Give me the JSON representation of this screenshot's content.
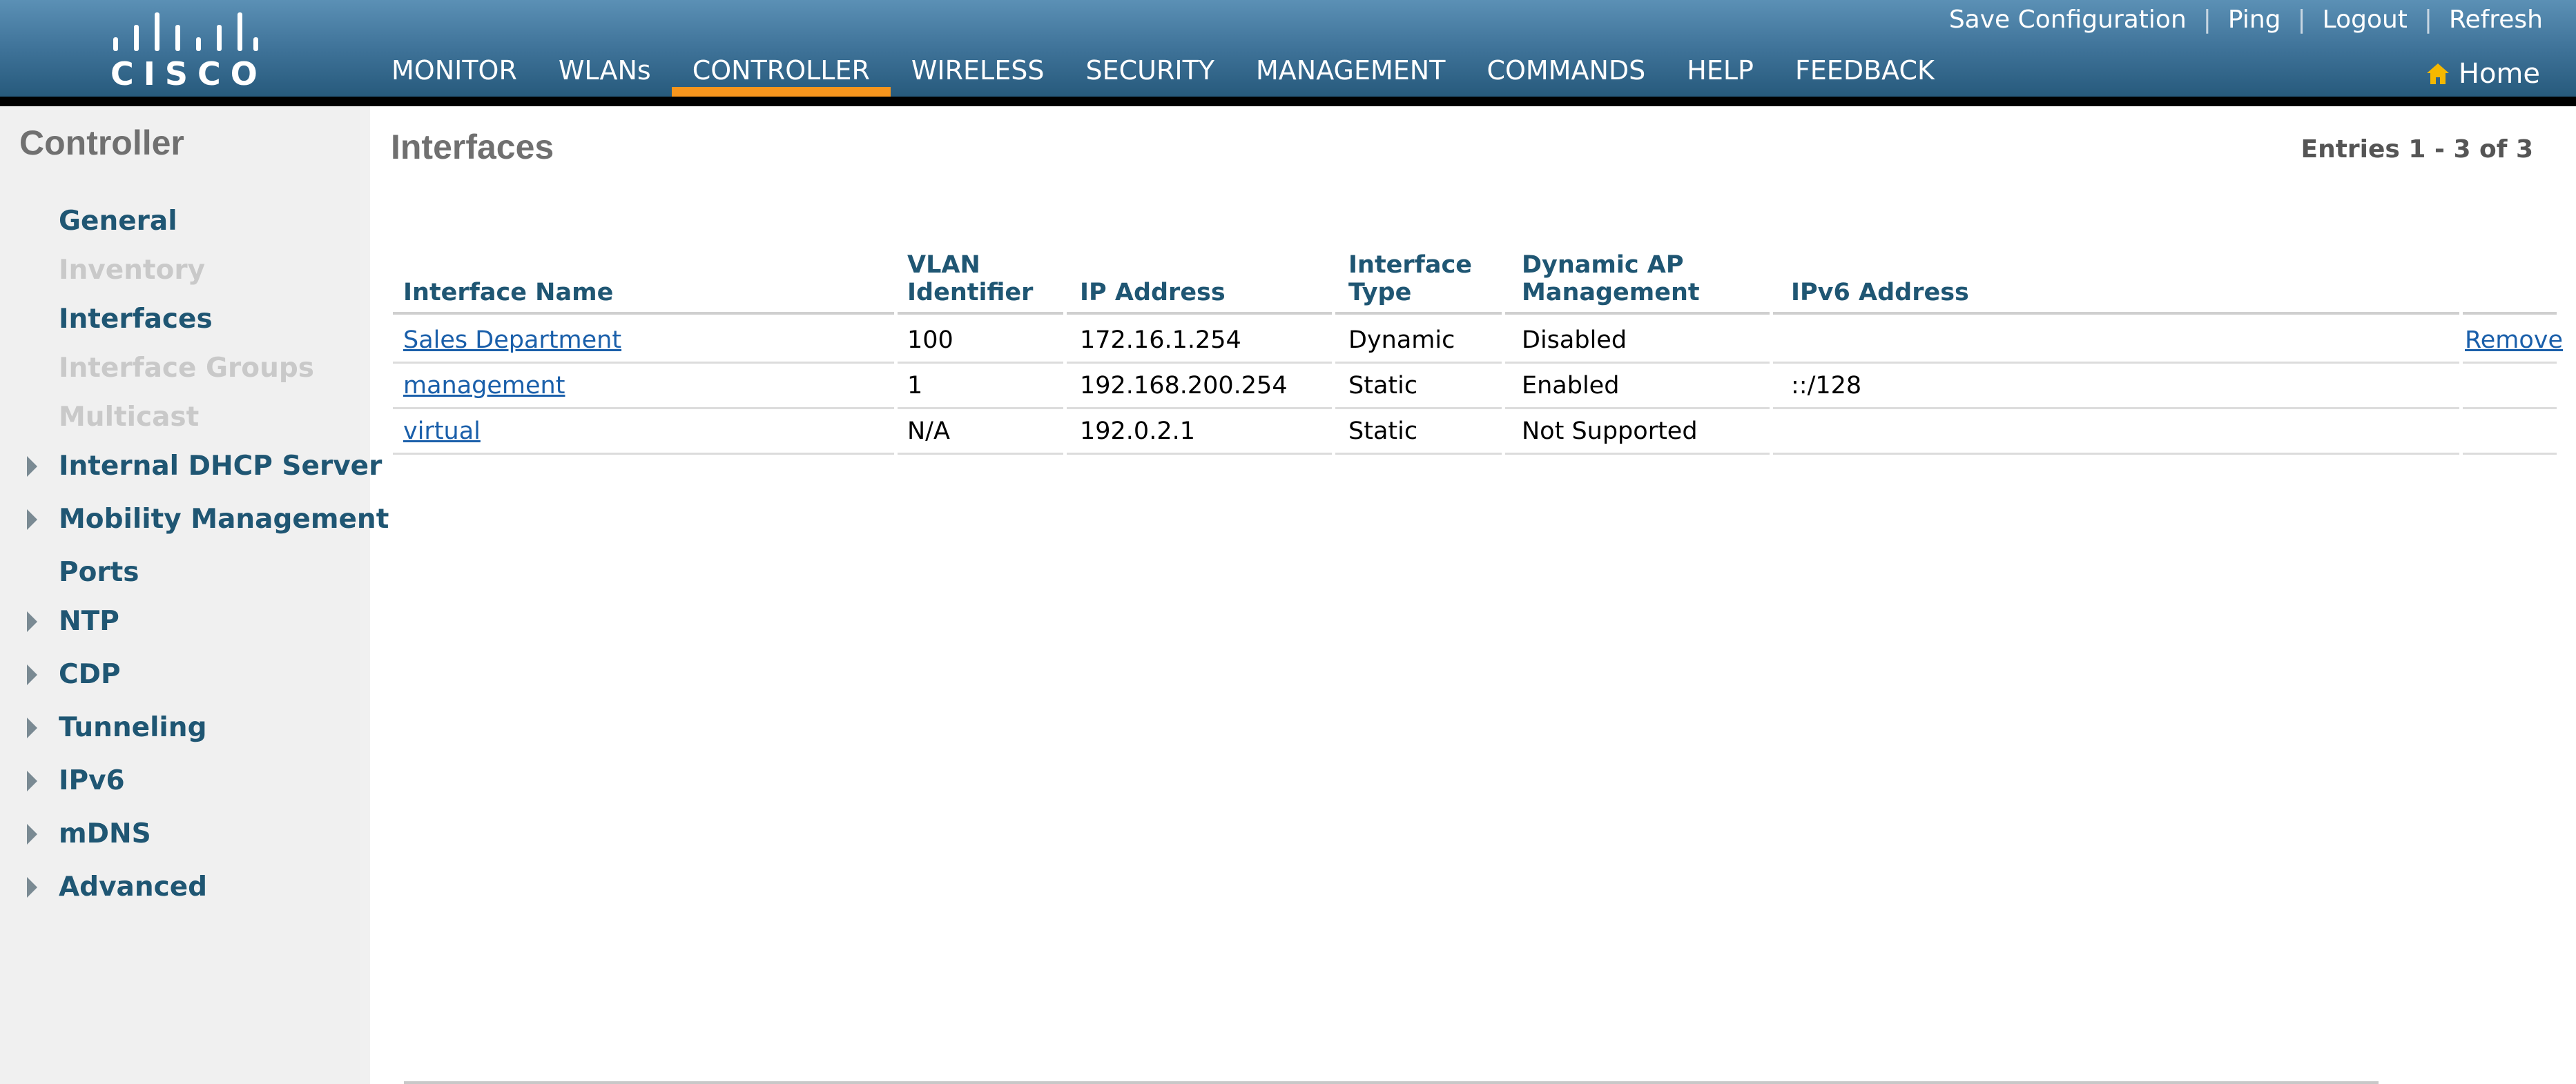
{
  "brand": {
    "logo_text": "CISCO"
  },
  "top_links": {
    "save_configuration": "Save Configuration",
    "ping": "Ping",
    "logout": "Logout",
    "refresh": "Refresh",
    "separator": "|"
  },
  "main_nav": {
    "monitor": "MONITOR",
    "wlans": "WLANs",
    "controller": "CONTROLLER",
    "wireless": "WIRELESS",
    "security": "SECURITY",
    "management": "MANAGEMENT",
    "commands": "COMMANDS",
    "help": "HELP",
    "feedback": "FEEDBACK",
    "active": "CONTROLLER"
  },
  "home": {
    "label": "Home",
    "icon": "home-icon"
  },
  "sidebar": {
    "title": "Controller",
    "items": [
      {
        "label": "General",
        "enabled": true,
        "expandable": false
      },
      {
        "label": "Inventory",
        "enabled": false,
        "expandable": false
      },
      {
        "label": "Interfaces",
        "enabled": true,
        "expandable": false
      },
      {
        "label": "Interface Groups",
        "enabled": false,
        "expandable": false
      },
      {
        "label": "Multicast",
        "enabled": false,
        "expandable": false
      },
      {
        "label": "Internal DHCP Server",
        "enabled": true,
        "expandable": true
      },
      {
        "label": "Mobility Management",
        "enabled": true,
        "expandable": true
      },
      {
        "label": "Ports",
        "enabled": true,
        "expandable": false
      },
      {
        "label": "NTP",
        "enabled": true,
        "expandable": true
      },
      {
        "label": "CDP",
        "enabled": true,
        "expandable": true
      },
      {
        "label": "Tunneling",
        "enabled": true,
        "expandable": true
      },
      {
        "label": "IPv6",
        "enabled": true,
        "expandable": true
      },
      {
        "label": "mDNS",
        "enabled": true,
        "expandable": true
      },
      {
        "label": "Advanced",
        "enabled": true,
        "expandable": true
      }
    ]
  },
  "main": {
    "title": "Interfaces",
    "entries": "Entries 1 - 3 of 3",
    "table": {
      "headers": {
        "interface_name": "Interface Name",
        "vlan_identifier_line1": "VLAN",
        "vlan_identifier_line2": "Identifier",
        "ip_address": "IP Address",
        "interface_type_line1": "Interface",
        "interface_type_line2": "Type",
        "dynamic_ap_line1": "Dynamic AP",
        "dynamic_ap_line2": "Management",
        "ipv6_address": "IPv6 Address"
      },
      "rows": [
        {
          "interface_name": "Sales Department",
          "vlan": "100",
          "ip": "172.16.1.254",
          "type": "Dynamic",
          "dynamic_ap": "Disabled",
          "ipv6": "",
          "action": "Remove"
        },
        {
          "interface_name": "management",
          "vlan": "1",
          "ip": "192.168.200.254",
          "type": "Static",
          "dynamic_ap": "Enabled",
          "ipv6": "::/128",
          "action": ""
        },
        {
          "interface_name": "virtual",
          "vlan": "N/A",
          "ip": "192.0.2.1",
          "type": "Static",
          "dynamic_ap": "Not Supported",
          "ipv6": "",
          "action": ""
        }
      ]
    }
  },
  "colors": {
    "header_top": "#5b90b5",
    "header_bottom": "#275a7c",
    "active_tab": "#f7951d",
    "sidebar_bg": "#f0f0f0",
    "sidebar_link": "#1f5673",
    "table_link": "#1a5faa",
    "home_icon": "#f5b800"
  }
}
